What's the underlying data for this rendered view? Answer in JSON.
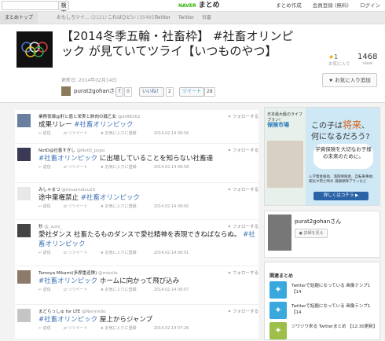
{
  "topbar": {
    "search_button": "検索",
    "logo_brand": "NAVER",
    "logo_text": "まとめ",
    "links": [
      "まとめ作成",
      "会員登録 (無料)",
      "ログイン"
    ]
  },
  "breadcrumbs": {
    "home": "まとめトップ",
    "categories": [
      {
        "label": "おもしろツイ…",
        "count": "(2121)"
      },
      {
        "label": "これはひどい",
        "count": "(35495)"
      },
      {
        "label": "Twitter",
        "count": ""
      },
      {
        "label": "Twitter",
        "count": ""
      },
      {
        "label": "社畜",
        "count": ""
      }
    ]
  },
  "header": {
    "title": "【2014冬季五輪・社畜枠】 #社畜オリンピック が見ていてツライ【いつものやつ】",
    "updated": "更新日: 2014年02月14日",
    "curator": "purat2gohanさん",
    "share": {
      "facebook_label": "f",
      "facebook_count": "0",
      "like_label": "いいね！",
      "like_count": "2",
      "tweet_label": "ツイート",
      "tweet_count": "28"
    },
    "favorites": "1",
    "favorites_label": "お気に入り",
    "views": "1468",
    "views_label": "view",
    "fav_button": "お気に入り追加"
  },
  "tweets": [
    {
      "name": "業務夜線@射と盾と栄実と肺肉の戦乙女",
      "handle": "@er88262",
      "text_pre": "成果リレー ",
      "hashtag": "#社畜オリンピック",
      "text_post": "",
      "date": "2014.02.14 08:56",
      "avatar_color": "#6a7fa0"
    },
    {
      "name": "NotD@社畜すぎし",
      "handle": "@NotD_popo",
      "text_pre": "",
      "hashtag": "#社畜オリンピック",
      "text_post": " に出場していることを知らない社畜達",
      "date": "2014.02.14 08:58",
      "avatar_color": "#3a3a55"
    },
    {
      "name": "みしゃまつ",
      "handle": "@misamatsu23",
      "text_pre": "途中棄権禁止 ",
      "hashtag": "#社畜オリンピック",
      "text_post": "",
      "date": "2014.02.14 08:00",
      "avatar_color": "#e8e8e8"
    },
    {
      "name": "秒",
      "handle": "@_zuro_",
      "text_pre": "愛社ダンス 社畜たるものダンスで愛社精神を表現できねばならぬ。 ",
      "hashtag": "#社畜オリンピック",
      "text_post": "",
      "date": "2014.02.14 08:01",
      "avatar_color": "#444"
    },
    {
      "name": "Tomoya Mikami(多摩重巡隊)",
      "handle": "@missile",
      "text_pre": "",
      "hashtag": "#社畜オリンピック",
      "text_post": " ホームに向かって飛び込み",
      "date": "2014.02.14 08:07",
      "avatar_color": "#8c7b6a"
    },
    {
      "name": "まどらっしゅ for LTE",
      "handle": "@Nerimido",
      "text_pre": "",
      "hashtag": "#社畜オリンピック",
      "text_post": " 屋上からジャンプ",
      "date": "2014.02.14 07:26",
      "avatar_color": "#c5c5c5"
    }
  ],
  "tweet_actions": {
    "reply": "返信",
    "retweet": "リツイート",
    "favorite": "お気に入りに登録",
    "follow": "フォローする"
  },
  "ad": {
    "top_small": "日本最大級のライフプラン!",
    "site": "保険市場",
    "headline_1": "この子は",
    "headline_em": "将来",
    "headline_2": "、",
    "headline_3": "何になるだろう?",
    "bubble": "学資保険を大切なお子様の未来のために。",
    "small": "入学資金援助、満期保険金、自転車事故、病気や死亡時の 満額保障プランなど",
    "button": "詳しくはコチラ ▶"
  },
  "profile": {
    "name": "purat2gohanさん",
    "button": "● 詳細を見る"
  },
  "related": {
    "heading": "関連まとめ",
    "items": [
      "Twitterで話題になっている 画像テンプ1【14",
      "Twitterで話題になっている 画像テンプ1【14",
      "ジワジワ来る Twitterまとめ 【12:30更新】"
    ]
  }
}
